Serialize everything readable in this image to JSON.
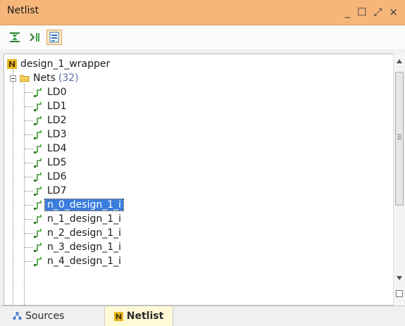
{
  "window": {
    "title": "Netlist",
    "controls": [
      "_",
      "☐",
      "⤢",
      "×"
    ]
  },
  "toolbar": {
    "buttons": [
      {
        "icon": "collapse-all-icon"
      },
      {
        "icon": "expand-all-icon"
      },
      {
        "icon": "show-hierarchy-icon",
        "active": true
      }
    ]
  },
  "tree": {
    "root": {
      "label": "design_1_wrapper",
      "icon": "netlist-n-icon"
    },
    "nets_group": {
      "label": "Nets",
      "count": "(32)",
      "icon": "folder-icon",
      "expanded": true
    },
    "nets": [
      {
        "label": "LD0"
      },
      {
        "label": "LD1"
      },
      {
        "label": "LD2"
      },
      {
        "label": "LD3"
      },
      {
        "label": "LD4"
      },
      {
        "label": "LD5"
      },
      {
        "label": "LD6"
      },
      {
        "label": "LD7"
      },
      {
        "label": "n_0_design_1_i",
        "selected": true
      },
      {
        "label": "n_1_design_1_i"
      },
      {
        "label": "n_2_design_1_i"
      },
      {
        "label": "n_3_design_1_i"
      },
      {
        "label": "n_4_design_1_i"
      }
    ]
  },
  "tabs": {
    "sources": "Sources",
    "netlist": "Netlist"
  },
  "colors": {
    "titlebar": "#f6b67a",
    "selection": "#3b7ddd",
    "net_icon": "#3c9a2e"
  }
}
